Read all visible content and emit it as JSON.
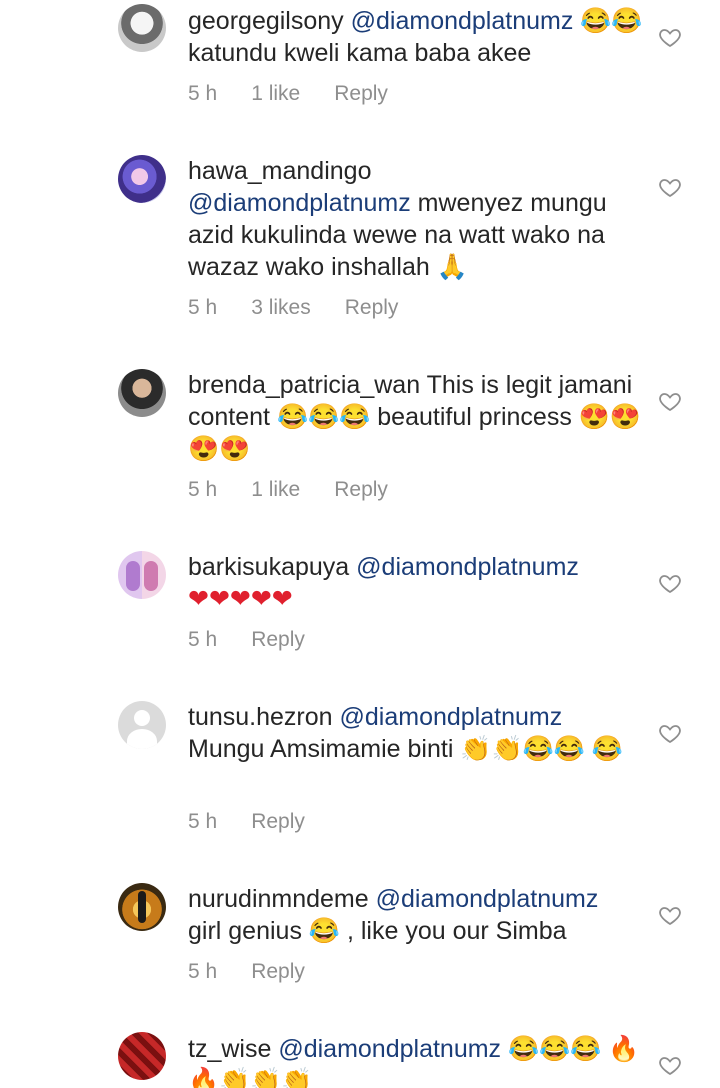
{
  "comments": [
    {
      "username": "georgegilsony",
      "mention": "@diamondplatnumz",
      "text": "😂😂 katundu kweli kama baba akee",
      "time": "5 h",
      "likes": "1 like",
      "reply": "Reply"
    },
    {
      "username": "hawa_mandingo",
      "mention": "@diamondplatnumz",
      "text": "mwenyez mungu azid kukulinda wewe na watt wako na wazaz wako inshallah 🙏",
      "time": "5 h",
      "likes": "3 likes",
      "reply": "Reply"
    },
    {
      "username": "brenda_patricia_wan",
      "text": "This is legit jamani content 😂😂😂 beautiful princess 😍😍😍😍",
      "time": "5 h",
      "likes": "1 like",
      "reply": "Reply"
    },
    {
      "username": "barkisukapuya",
      "mention": "@diamondplatnumz",
      "text": "❤❤❤❤❤",
      "time": "5 h",
      "reply": "Reply"
    },
    {
      "username": "tunsu.hezron",
      "mention": "@diamondplatnumz",
      "text": "Mungu Amsimamie binti 👏👏😂😂 😂",
      "time": "5 h",
      "reply": "Reply"
    },
    {
      "username": "nurudinmndeme",
      "mention": "@diamondplatnumz",
      "text": "girl genius 😂 , like you our Simba",
      "time": "5 h",
      "reply": "Reply"
    },
    {
      "username": "tz_wise",
      "mention": "@diamondplatnumz",
      "text": "😂😂😂 🔥🔥👏👏👏"
    }
  ],
  "icons": {
    "like": "heart-outline-icon",
    "avatar_placeholder": "default-avatar-icon"
  }
}
